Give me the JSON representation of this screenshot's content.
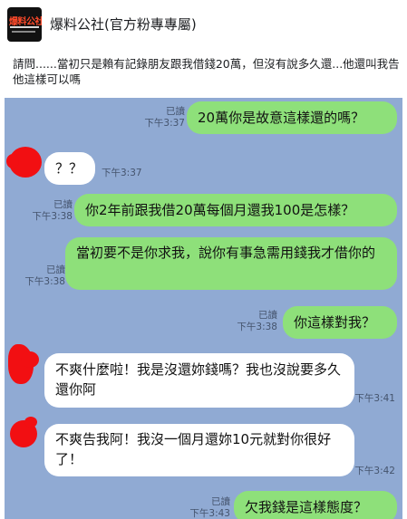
{
  "page": {
    "avatar_text": "爆料公社",
    "name": "爆料公社(官方粉專專屬)"
  },
  "post": {
    "text": "請問......當初只是賴有記錄朋友跟我借錢20萬，但沒有說多久還...他還叫我告他這樣可以嗎"
  },
  "chat": {
    "messages": [
      {
        "side": "out",
        "text": "20萬你是故意這樣還的嗎？",
        "read": "已讀",
        "time": "下午3:37"
      },
      {
        "side": "in",
        "text": "？？",
        "time": "下午3:37"
      },
      {
        "side": "out",
        "text": "你2年前跟我借20萬每個月還我100是怎樣？",
        "read": "已讀",
        "time": "下午3:38"
      },
      {
        "side": "out",
        "text": "當初要不是你求我，說你有事急需用錢我才借你的",
        "read": "已讀",
        "time": "下午3:38"
      },
      {
        "side": "out",
        "text": "你這樣對我？",
        "read": "已讀",
        "time": "下午3:38"
      },
      {
        "side": "in",
        "text": "不爽什麼啦！我是沒還妳錢嗎？我也沒說要多久還你阿",
        "time": "下午3:41"
      },
      {
        "side": "in",
        "text": "不爽告我阿！我沒一個月還妳10元就對你很好了！",
        "time": "下午3:42"
      },
      {
        "side": "out",
        "text": "欠我錢是這樣態度？",
        "read": "已讀",
        "time": "下午3:43"
      }
    ]
  },
  "colors": {
    "chat_background": "#90aad3",
    "outgoing_bubble": "#8ee07a",
    "incoming_bubble": "#ffffff",
    "redaction": "#f20f12"
  },
  "icons": [
    "page-logo-icon",
    "redacted-avatar-icon"
  ]
}
